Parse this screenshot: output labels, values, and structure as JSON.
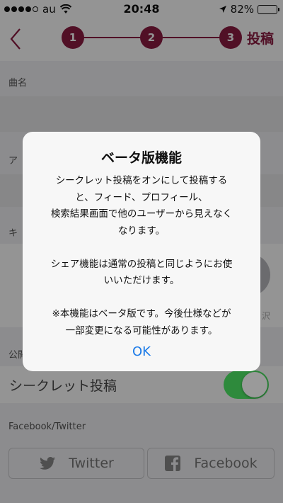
{
  "status_bar": {
    "carrier": "au",
    "time": "20:48",
    "battery": "82%",
    "battery_level": 0.82
  },
  "nav": {
    "steps": [
      "1",
      "2",
      "3"
    ],
    "current_step_label": "投稿",
    "accent_color": "#8c1d42"
  },
  "form": {
    "song_name_label": "曲名",
    "artist_label_partial": "ア",
    "keyword_label_partial": "キ",
    "select_label_partial": "沢",
    "public_label_partial": "公開",
    "secret_post_label": "シークレット投稿",
    "secret_post_on": true,
    "social_section_label": "Facebook/Twitter",
    "twitter_button": "Twitter",
    "facebook_button": "Facebook"
  },
  "modal": {
    "title": "ベータ版機能",
    "body_lines_1": [
      "シークレット投稿をオンにして投稿する",
      "と、フィード、プロフィール、",
      "検索結果画面で他のユーザーから見えなく",
      "なります。"
    ],
    "body_lines_2": [
      "シェア機能は通常の投稿と同じようにお使",
      "いいただけます。"
    ],
    "body_lines_3": [
      "※本機能はベータ版です。今後仕様などが",
      "一部変更になる可能性があります。"
    ],
    "ok_label": "OK"
  }
}
